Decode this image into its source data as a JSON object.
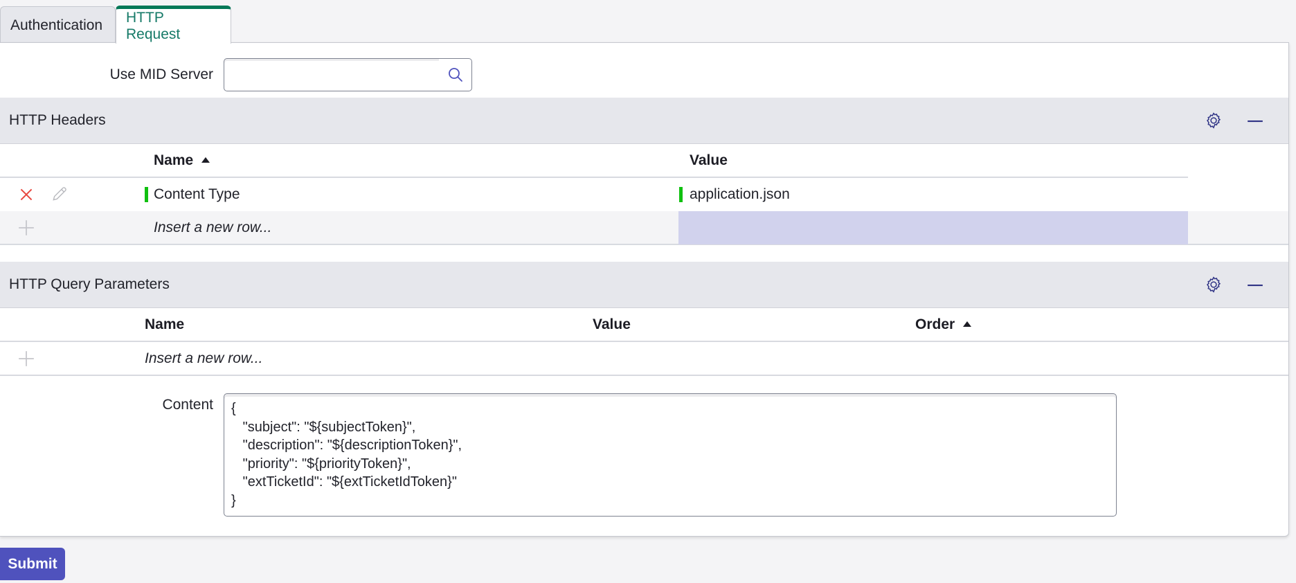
{
  "tabs": [
    {
      "label": "Authentication",
      "active": false
    },
    {
      "label": "HTTP Request",
      "active": true
    }
  ],
  "mid_server": {
    "label": "Use MID Server",
    "value": "",
    "search_icon": "search-icon"
  },
  "http_headers": {
    "title": "HTTP Headers",
    "icons": {
      "settings": "gear-icon",
      "collapse": "minus-icon"
    },
    "columns": [
      {
        "label": "Name",
        "sort": "ascending"
      },
      {
        "label": "Value"
      }
    ],
    "rows": [
      {
        "name": "Content Type",
        "value": "application.json",
        "row_icons": [
          "delete-icon",
          "edit-icon"
        ]
      }
    ],
    "insert_row_label": "Insert a new row..."
  },
  "http_query_parameters": {
    "title": "HTTP Query Parameters",
    "icons": {
      "settings": "gear-icon",
      "collapse": "minus-icon"
    },
    "columns": [
      {
        "label": "Name"
      },
      {
        "label": "Value"
      },
      {
        "label": "Order",
        "sort": "ascending"
      }
    ],
    "rows": [],
    "insert_row_label": "Insert a new row..."
  },
  "content": {
    "label": "Content",
    "value": "{\n   \"subject\": \"${subjectToken}\",\n   \"description\": \"${descriptionToken}\",\n   \"priority\": \"${priorityToken}\",\n   \"extTicketId\": \"${extTicketIdToken}\"\n}"
  },
  "submit_label": "Submit",
  "colors": {
    "active_tab_accent": "#047857",
    "active_tab_text": "#167a68",
    "submit_bg": "#4f52bd",
    "changed_marker": "#10c010",
    "delete_icon": "#e8473f",
    "selected_cell": "#d1d2ed"
  }
}
